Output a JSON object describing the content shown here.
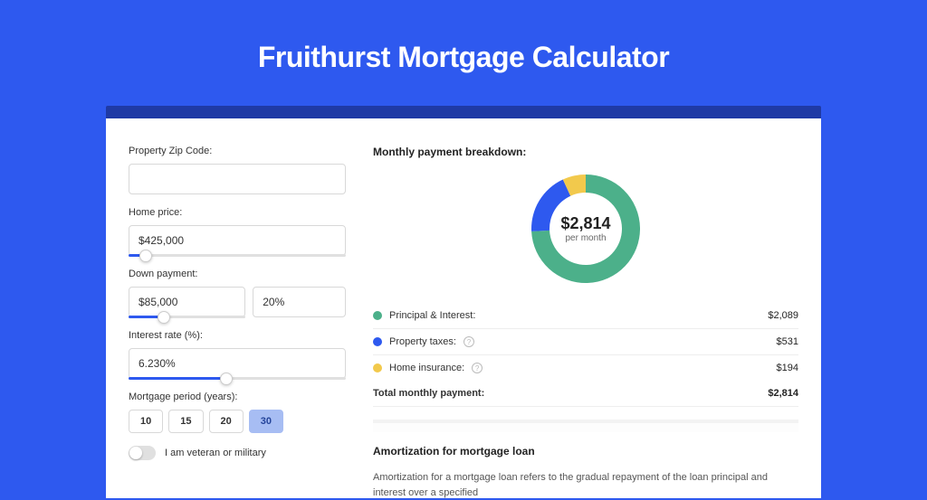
{
  "title": "Fruithurst Mortgage Calculator",
  "form": {
    "zip_label": "Property Zip Code:",
    "zip_value": "",
    "price_label": "Home price:",
    "price_value": "$425,000",
    "price_slider_pct": 8,
    "down_label": "Down payment:",
    "down_value": "$85,000",
    "down_pct_value": "20%",
    "down_slider_pct": 30,
    "rate_label": "Interest rate (%):",
    "rate_value": "6.230%",
    "rate_slider_pct": 45,
    "period_label": "Mortgage period (years):",
    "periods": [
      "10",
      "15",
      "20",
      "30"
    ],
    "period_active": "30",
    "veteran_label": "I am veteran or military"
  },
  "breakdown": {
    "title": "Monthly payment breakdown:",
    "amount": "$2,814",
    "sub": "per month",
    "items": [
      {
        "label": "Principal & Interest:",
        "value": "$2,089",
        "color": "#4cb08a",
        "pct": 74,
        "info": false
      },
      {
        "label": "Property taxes:",
        "value": "$531",
        "color": "#2e59ef",
        "pct": 19,
        "info": true
      },
      {
        "label": "Home insurance:",
        "value": "$194",
        "color": "#f2c94c",
        "pct": 7,
        "info": true
      }
    ],
    "total_label": "Total monthly payment:",
    "total_value": "$2,814"
  },
  "amort": {
    "title": "Amortization for mortgage loan",
    "text": "Amortization for a mortgage loan refers to the gradual repayment of the loan principal and interest over a specified"
  },
  "chart_data": {
    "type": "pie",
    "title": "Monthly payment breakdown",
    "series": [
      {
        "name": "Principal & Interest",
        "value": 2089,
        "color": "#4cb08a"
      },
      {
        "name": "Property taxes",
        "value": 531,
        "color": "#2e59ef"
      },
      {
        "name": "Home insurance",
        "value": 194,
        "color": "#f2c94c"
      }
    ],
    "total": 2814,
    "center_label": "$2,814 per month"
  }
}
